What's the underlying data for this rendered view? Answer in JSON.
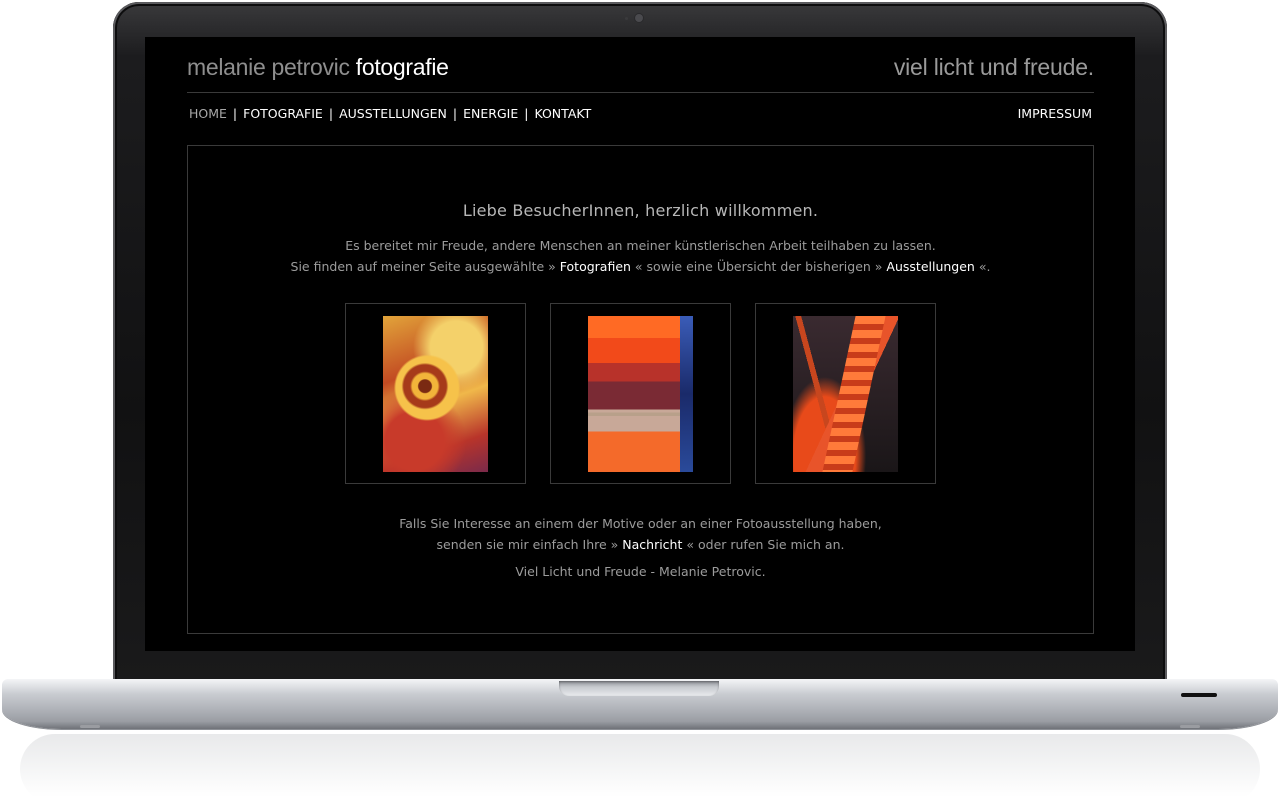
{
  "site": {
    "logo_light": "melanie petrovic",
    "logo_bold": "fotografie",
    "tagline": "viel licht und freude."
  },
  "nav": {
    "items": [
      {
        "label": "HOME",
        "active": true
      },
      {
        "label": "FOTOGRAFIE",
        "active": false
      },
      {
        "label": "AUSSTELLUNGEN",
        "active": false
      },
      {
        "label": "ENERGIE",
        "active": false
      },
      {
        "label": "KONTAKT",
        "active": false
      }
    ],
    "separator": "|",
    "impressum": "IMPRESSUM"
  },
  "content": {
    "welcome": "Liebe BesucherInnen, herzlich willkommen.",
    "intro_line1": "Es bereitet mir Freude, andere Menschen an meiner künstlerischen Arbeit teilhaben zu lassen.",
    "intro_line2_a": "Sie finden auf meiner Seite ausgewählte » ",
    "intro_link_fotografien": "Fotografien",
    "intro_line2_b": " « sowie eine Übersicht der bisherigen » ",
    "intro_link_ausstellungen": "Ausstellungen",
    "intro_line2_c": " «.",
    "outro_line1": "Falls Sie Interesse an einem der Motive oder an einer Fotoausstellung haben,",
    "outro_line2_a": "senden sie mir einfach Ihre » ",
    "outro_link_nachricht": "Nachricht",
    "outro_line2_b": " « oder rufen Sie mich an.",
    "signature": "Viel Licht und Freude - Melanie Petrovic."
  },
  "gallery": {
    "thumbnails": [
      {
        "name": "orange-glass-swirl-photo"
      },
      {
        "name": "red-orange-blocks-photo"
      },
      {
        "name": "red-glass-ridge-photo"
      }
    ]
  },
  "colors": {
    "background": "#000000",
    "text_muted": "#9c9c9c",
    "link": "#ffffff",
    "border": "#3a3a3a"
  }
}
